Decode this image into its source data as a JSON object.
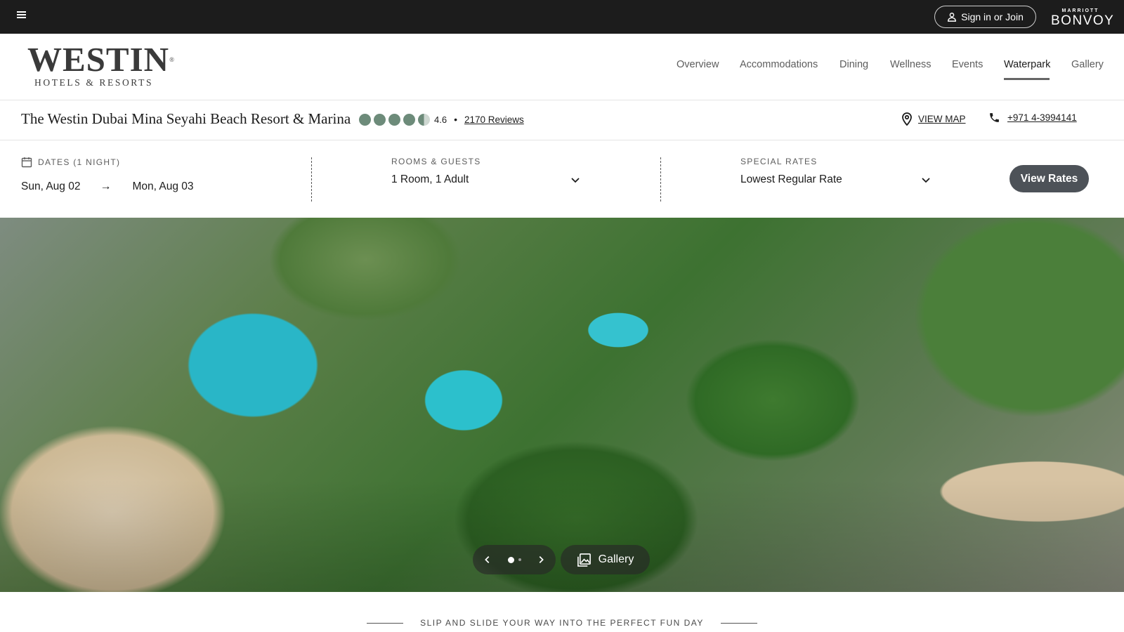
{
  "topbar": {
    "menu_icon": "hamburger-icon",
    "signin_label": "Sign in or Join",
    "signin_icon": "person-icon",
    "brand_top": "MARRIOTT",
    "brand_main": "BONVOY"
  },
  "header": {
    "logo_main": "WESTIN",
    "logo_sub": "HOTELS & RESORTS",
    "nav": [
      {
        "label": "Overview"
      },
      {
        "label": "Accommodations"
      },
      {
        "label": "Dining"
      },
      {
        "label": "Wellness"
      },
      {
        "label": "Events"
      },
      {
        "label": "Waterpark"
      },
      {
        "label": "Gallery"
      }
    ],
    "active_nav": "Waterpark"
  },
  "hotel": {
    "name": "The Westin Dubai Mina Seyahi Beach Resort & Marina",
    "rating": "4.6",
    "rating_value": 4.6,
    "rating_separator": "•",
    "reviews": "2170 Reviews",
    "view_map": "VIEW MAP",
    "phone": "+971 4-3994141"
  },
  "booking": {
    "dates_label": "DATES (1 NIGHT)",
    "checkin": "Sun, Aug 02",
    "arrow": "→",
    "checkout": "Mon, Aug 03",
    "rooms_label": "ROOMS & GUESTS",
    "rooms_value": "1 Room, 1 Adult",
    "rates_label": "SPECIAL RATES",
    "rates_value": "Lowest Regular Rate",
    "cta": "View Rates"
  },
  "hero": {
    "gallery_label": "Gallery",
    "slide_count": 2,
    "active_slide": 1
  },
  "tagline": "SLIP AND SLIDE YOUR WAY INTO THE PERFECT FUN DAY",
  "colors": {
    "topbar": "#1c1c1c",
    "rating_dot": "#6d8b7a",
    "cta_bg": "#4d5258"
  }
}
